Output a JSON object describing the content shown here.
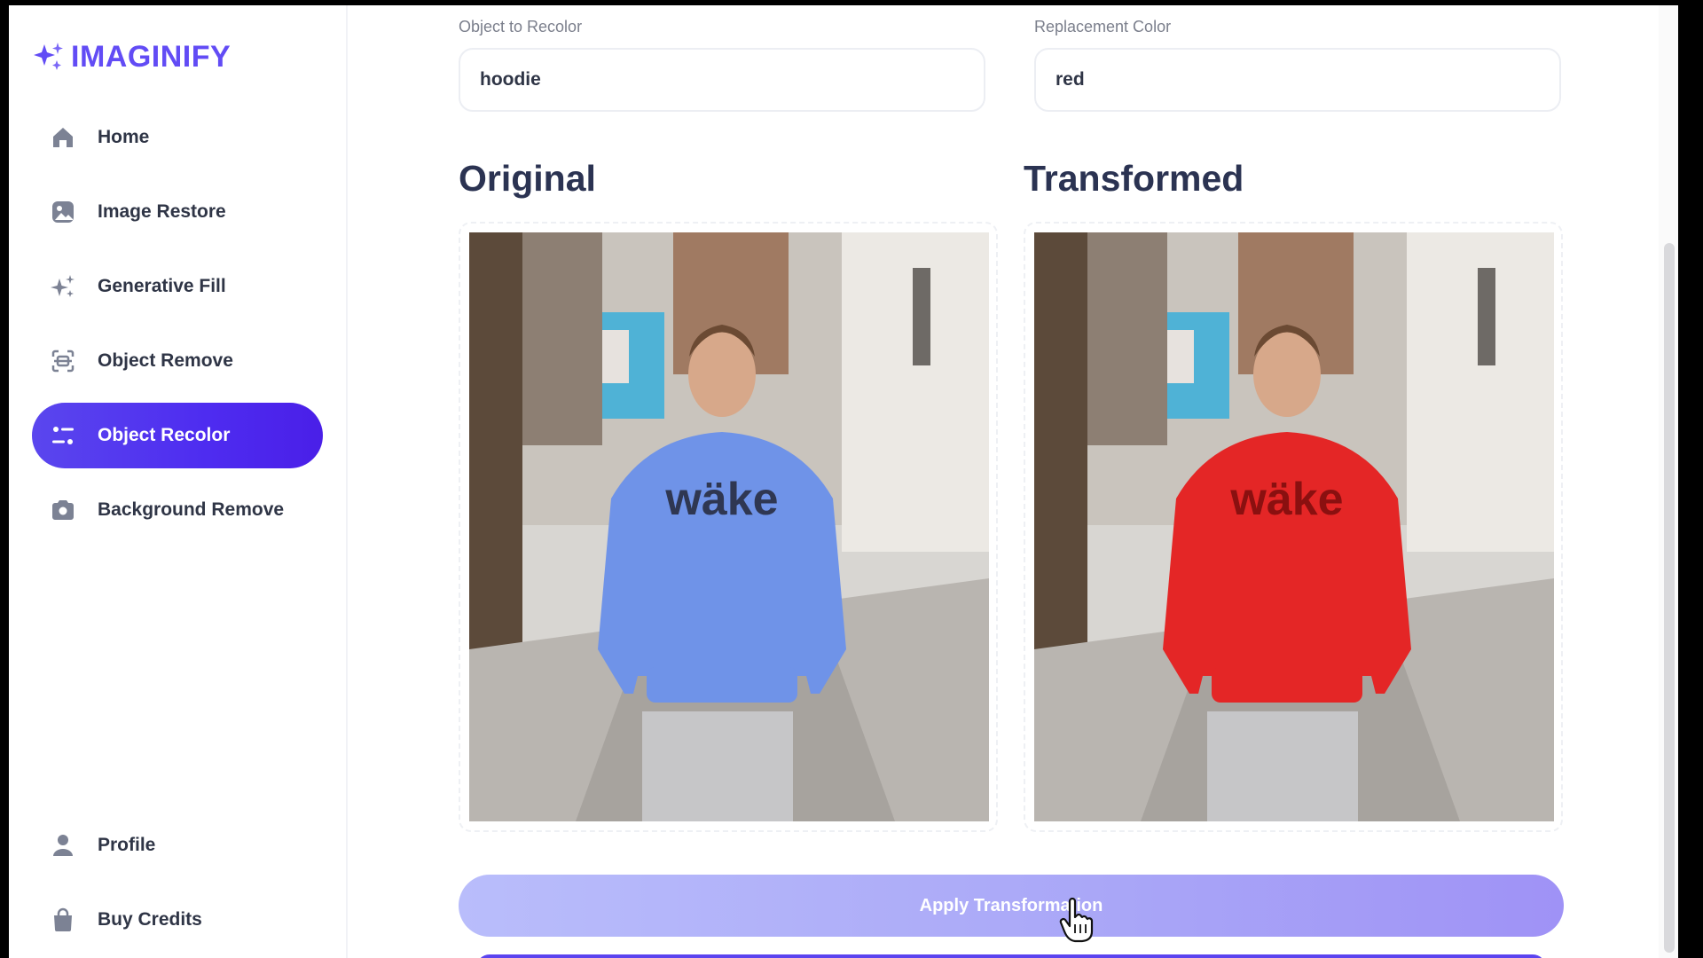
{
  "app": {
    "name": "IMAGINIFY"
  },
  "sidebar": {
    "items": [
      {
        "label": "Home",
        "icon": "home-icon"
      },
      {
        "label": "Image Restore",
        "icon": "image-icon"
      },
      {
        "label": "Generative Fill",
        "icon": "sparkles-icon"
      },
      {
        "label": "Object Remove",
        "icon": "scan-icon"
      },
      {
        "label": "Object Recolor",
        "icon": "filter-icon",
        "active": true
      },
      {
        "label": "Background Remove",
        "icon": "camera-icon"
      }
    ],
    "bottom_items": [
      {
        "label": "Profile",
        "icon": "user-icon"
      },
      {
        "label": "Buy Credits",
        "icon": "bag-icon"
      }
    ]
  },
  "form": {
    "object_label": "Object to Recolor",
    "object_value": "hoodie",
    "color_label": "Replacement Color",
    "color_value": "red"
  },
  "preview": {
    "original_title": "Original",
    "transformed_title": "Transformed",
    "shirt_text": "wäke",
    "original_hoodie_color": "#6f93e8",
    "transformed_hoodie_color": "#e42626"
  },
  "actions": {
    "apply_label": "Apply Transformation"
  },
  "colors": {
    "accent": "#624cf5",
    "active_nav": "#4e2cf0",
    "text_dark": "#2f3546"
  }
}
